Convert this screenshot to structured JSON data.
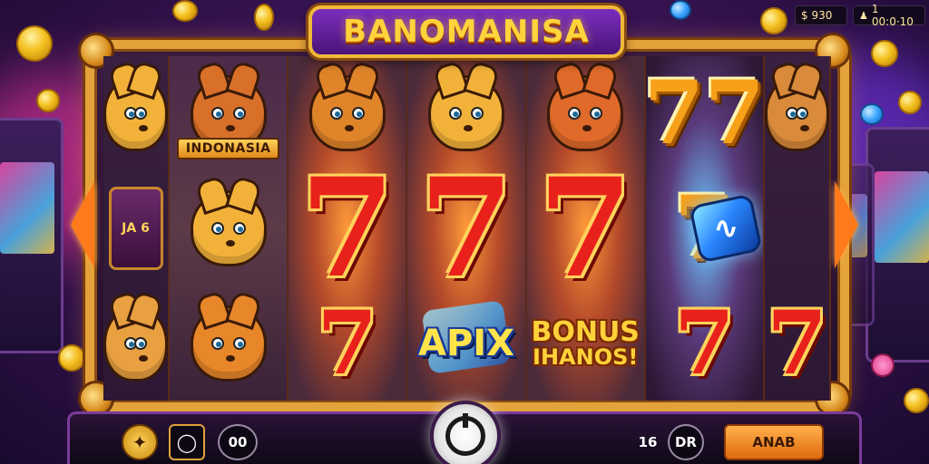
{
  "game": {
    "title": "BANOMANISA"
  },
  "balance": {
    "credits_label": "$ 930",
    "win_label": "1 00:0·10",
    "win_icon": "person-icon"
  },
  "reels": [
    {
      "kind": "side",
      "symbols": [
        {
          "type": "animal",
          "color": "#f2b23a"
        },
        {
          "type": "card",
          "text": "JA 6"
        },
        {
          "type": "animal",
          "color": "#e8a040"
        }
      ]
    },
    {
      "kind": "normal",
      "label_plate": "INDONASIA",
      "symbols": [
        {
          "type": "animal",
          "color": "#d9702a"
        },
        {
          "type": "animal",
          "color": "#f2b23a"
        },
        {
          "type": "animal",
          "color": "#e8862a"
        }
      ]
    },
    {
      "kind": "glow",
      "symbols": [
        {
          "type": "animal",
          "color": "#e0842a"
        },
        {
          "type": "seven",
          "text": "7"
        },
        {
          "type": "seven",
          "text": "7"
        }
      ]
    },
    {
      "kind": "glow",
      "symbols": [
        {
          "type": "animal",
          "color": "#f2b23a"
        },
        {
          "type": "seven",
          "text": "7"
        },
        {
          "type": "apix",
          "text": "APIX"
        }
      ]
    },
    {
      "kind": "glow",
      "symbols": [
        {
          "type": "animal",
          "color": "#e06a2a"
        },
        {
          "type": "seven",
          "text": "7"
        },
        {
          "type": "bonus",
          "line1": "BONUS",
          "line2": "IHANOS!"
        }
      ]
    },
    {
      "kind": "blue",
      "symbols": [
        {
          "type": "seven",
          "text": "77"
        },
        {
          "type": "seven",
          "text": "7"
        },
        {
          "type": "seven",
          "text": "7"
        }
      ]
    },
    {
      "kind": "side",
      "symbols": [
        {
          "type": "animal",
          "color": "#d98a3a"
        },
        {
          "type": "empty"
        },
        {
          "type": "seven",
          "text": "7"
        }
      ]
    }
  ],
  "controls": {
    "coin_button_icon": "coin-icon",
    "search_button_icon": "search-icon",
    "oo_button_label": "00",
    "spin_button_icon": "spin-icon",
    "lines_value": "16",
    "dr_button_label": "DR",
    "action_button_label": "ANAB"
  },
  "colors": {
    "frame": "#e4a23a",
    "accent": "#ff7a1a",
    "title_text": "#ffd33b"
  }
}
